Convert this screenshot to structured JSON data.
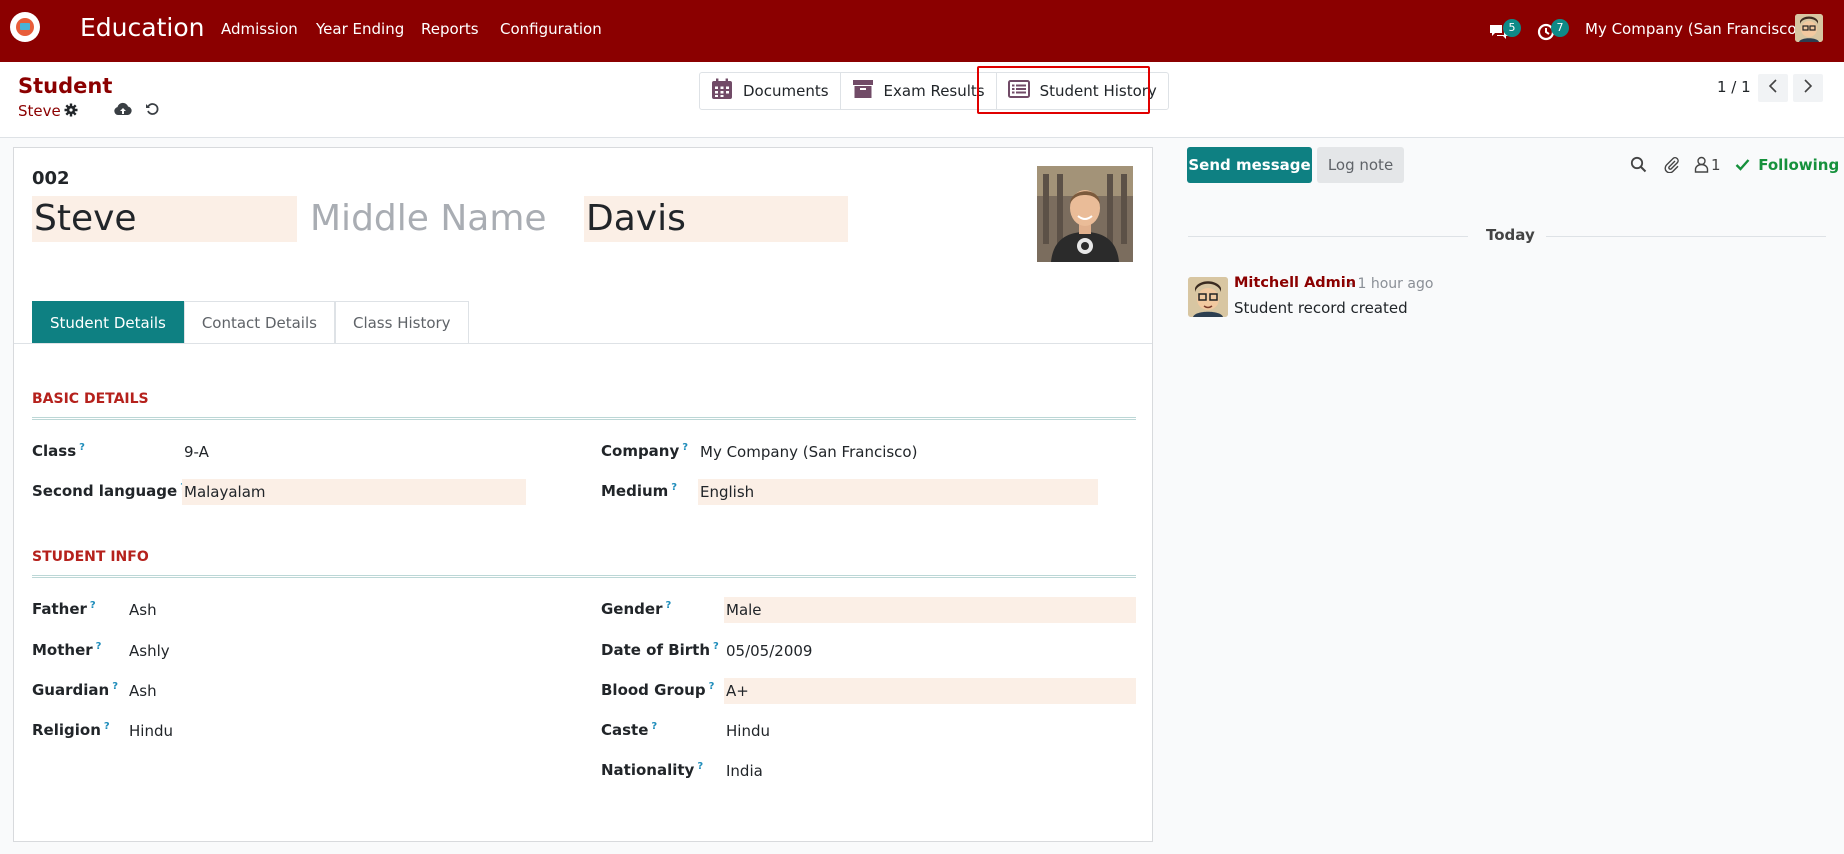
{
  "navbar": {
    "app_name": "Education",
    "menu": [
      "Admission",
      "Year Ending",
      "Reports",
      "Configuration"
    ],
    "messages_count": "5",
    "activities_count": "7",
    "company": "My Company (San Francisco)"
  },
  "control_panel": {
    "model": "Student",
    "record": "Steve",
    "smart_buttons": {
      "documents": "Documents",
      "exam_results": "Exam Results",
      "student_history": "Student History"
    },
    "pager": "1 / 1"
  },
  "form": {
    "ref_no": "002",
    "first_name": "Steve",
    "middle_name_placeholder": "Middle Name",
    "last_name": "Davis",
    "tabs": [
      "Student Details",
      "Contact Details",
      "Class History"
    ],
    "sections": {
      "basic": "BASIC DETAILS",
      "info": "STUDENT INFO"
    },
    "fields": {
      "class_label": "Class",
      "class_value": "9-A",
      "company_label": "Company",
      "company_value": "My Company (San Francisco)",
      "second_language_label": "Second language",
      "second_language_value": "Malayalam",
      "medium_label": "Medium",
      "medium_value": "English",
      "father_label": "Father",
      "father_value": "Ash",
      "gender_label": "Gender",
      "gender_value": "Male",
      "mother_label": "Mother",
      "mother_value": "Ashly",
      "dob_label": "Date of Birth",
      "dob_value": "05/05/2009",
      "guardian_label": "Guardian",
      "guardian_value": "Ash",
      "blood_group_label": "Blood Group",
      "blood_group_value": "A+",
      "religion_label": "Religion",
      "religion_value": "Hindu",
      "caste_label": "Caste",
      "caste_value": "Hindu",
      "nationality_label": "Nationality",
      "nationality_value": "India"
    },
    "help_marker": "?"
  },
  "chatter": {
    "send_message": "Send message",
    "log_note": "Log note",
    "followers": "1",
    "following": "Following",
    "date_separator": "Today",
    "message": {
      "author": "Mitchell Admin",
      "time": "- 1 hour ago",
      "body": "Student record created"
    }
  },
  "colors": {
    "brand": "#8b0000",
    "accent": "#0e8082",
    "highlight": "#e00000",
    "following": "#16913c"
  }
}
